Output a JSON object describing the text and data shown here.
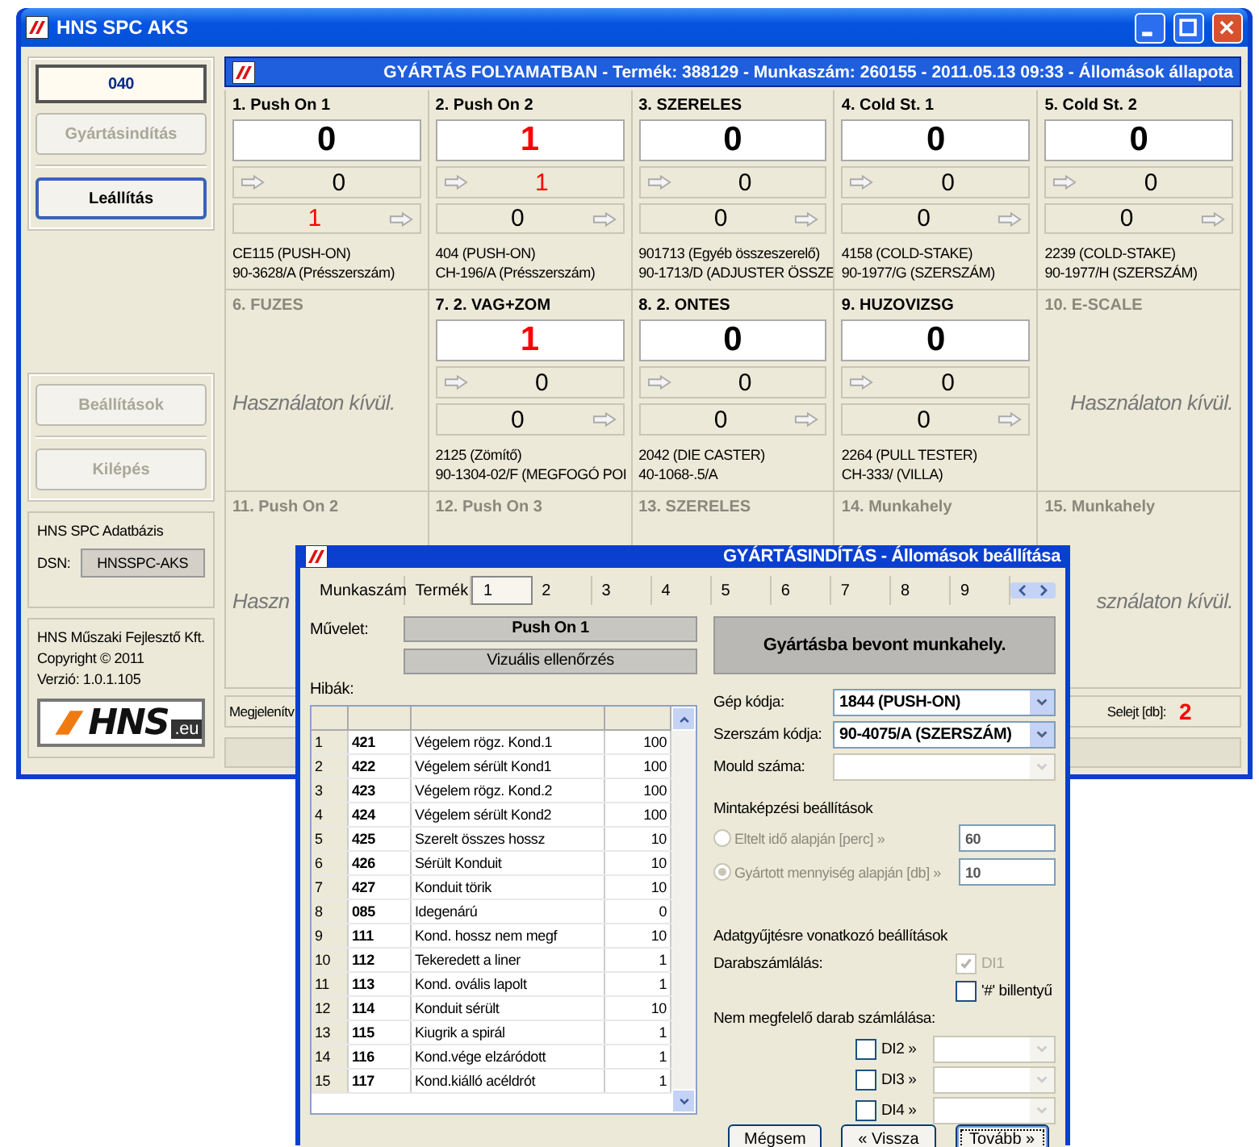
{
  "window": {
    "title": "HNS SPC AKS"
  },
  "sidebar": {
    "station_code": "040",
    "buttons": [
      {
        "label": "Gyártásindítás",
        "disabled": true
      },
      {
        "label": "Leállítás",
        "disabled": false
      }
    ],
    "buttons_lower": [
      {
        "label": "Beállítások",
        "disabled": true
      },
      {
        "label": "Kilépés",
        "disabled": true
      }
    ],
    "database": {
      "title": "HNS SPC Adatbázis",
      "dsn_label": "DSN:",
      "dsn": "HNSSPC-AKS"
    },
    "about": {
      "company": "HNS Műszaki Fejlesztő Kft.",
      "copyright": "Copyright © 2011",
      "version": "Verzió: 1.0.1.105",
      "logo": "HNS",
      "logo_suffix": ".eu"
    }
  },
  "header": "GYÁRTÁS FOLYAMATBAN - Termék: 388129 - Munkaszám: 260155 - 2011.05.13 09:33 - Állomások állapota",
  "stations": [
    {
      "kind": "active",
      "title": "1. Push On 1",
      "total": {
        "value": "0",
        "alert": false
      },
      "in": {
        "value": "0",
        "alert": false
      },
      "out": {
        "value": "1",
        "alert": true
      },
      "info": [
        "CE115 (PUSH-ON)",
        "90-3628/A (Présszerszám)"
      ]
    },
    {
      "kind": "active",
      "title": "2. Push On 2",
      "total": {
        "value": "1",
        "alert": true
      },
      "in": {
        "value": "1",
        "alert": true
      },
      "out": {
        "value": "0",
        "alert": false
      },
      "info": [
        "404 (PUSH-ON)",
        "CH-196/A (Présszerszám)"
      ]
    },
    {
      "kind": "active",
      "title": "3. SZERELES",
      "total": {
        "value": "0",
        "alert": false
      },
      "in": {
        "value": "0",
        "alert": false
      },
      "out": {
        "value": "0",
        "alert": false
      },
      "info": [
        "901713 (Egyéb összeszerelő)",
        "90-1713/D (ADJUSTER ÖSSZE"
      ]
    },
    {
      "kind": "active",
      "title": "4. Cold St. 1",
      "total": {
        "value": "0",
        "alert": false
      },
      "in": {
        "value": "0",
        "alert": false
      },
      "out": {
        "value": "0",
        "alert": false
      },
      "info": [
        "4158 (COLD-STAKE)",
        "90-1977/G (SZERSZÁM)"
      ]
    },
    {
      "kind": "active",
      "title": "5. Cold St. 2",
      "total": {
        "value": "0",
        "alert": false
      },
      "in": {
        "value": "0",
        "alert": false
      },
      "out": {
        "value": "0",
        "alert": false
      },
      "info": [
        "2239 (COLD-STAKE)",
        "90-1977/H (SZERSZÁM)"
      ]
    },
    {
      "kind": "out_of_use",
      "title": "6. FUZES",
      "status": "Használaton kívül."
    },
    {
      "kind": "active",
      "title": "7. 2. VAG+ZOM",
      "total": {
        "value": "1",
        "alert": true
      },
      "in": {
        "value": "0",
        "alert": false
      },
      "out": {
        "value": "0",
        "alert": false
      },
      "info": [
        "2125 (Zömítő)",
        "90-1304-02/F (MEGFOGÓ POI"
      ]
    },
    {
      "kind": "active",
      "title": "8. 2. ONTES",
      "total": {
        "value": "0",
        "alert": false
      },
      "in": {
        "value": "0",
        "alert": false
      },
      "out": {
        "value": "0",
        "alert": false
      },
      "info": [
        "2042 (DIE CASTER)",
        "40-1068-.5/A"
      ]
    },
    {
      "kind": "active",
      "title": "9. HUZOVIZSG",
      "total": {
        "value": "0",
        "alert": false
      },
      "in": {
        "value": "0",
        "alert": false
      },
      "out": {
        "value": "0",
        "alert": false
      },
      "info": [
        "2264 (PULL TESTER)",
        "CH-333/ (VILLA)"
      ]
    },
    {
      "kind": "out_of_use",
      "title": "10. E-SCALE",
      "status": "Használaton kívül."
    },
    {
      "kind": "out_of_use",
      "title": "11. Push On 2",
      "status": "Haszn"
    },
    {
      "kind": "out_of_use",
      "title": "12. Push On 3"
    },
    {
      "kind": "out_of_use",
      "title": "13. SZERELES"
    },
    {
      "kind": "out_of_use",
      "title": "14. Munkahely"
    },
    {
      "kind": "out_of_use",
      "title": "15. Munkahely",
      "status": "sználaton kívül."
    }
  ],
  "status_bar": {
    "label": "Megjelenítv",
    "reject_label": "Selejt [db]:",
    "reject_value": "2"
  },
  "dialog": {
    "title": "GYÁRTÁSINDÍTÁS - Állomások beállítása",
    "tabs": [
      {
        "label": "Munkaszám",
        "selected": false
      },
      {
        "label": "Termék",
        "selected": false
      },
      {
        "label": "1",
        "selected": true
      },
      {
        "label": "2",
        "selected": false
      },
      {
        "label": "3",
        "selected": false
      },
      {
        "label": "4",
        "selected": false
      },
      {
        "label": "5",
        "selected": false
      },
      {
        "label": "6",
        "selected": false
      },
      {
        "label": "7",
        "selected": false
      },
      {
        "label": "8",
        "selected": false
      },
      {
        "label": "9",
        "selected": false
      }
    ],
    "operation_label": "Művelet:",
    "operation": "Push On 1",
    "check_type": "Vizuális ellenőrzés",
    "defects_label": "Hibák:",
    "defects": [
      {
        "index": "1",
        "code": "421",
        "name": "Végelem rögz. Kond.1",
        "limit": "100"
      },
      {
        "index": "2",
        "code": "422",
        "name": "Végelem sérült Kond1",
        "limit": "100"
      },
      {
        "index": "3",
        "code": "423",
        "name": "Végelem rögz. Kond.2",
        "limit": "100"
      },
      {
        "index": "4",
        "code": "424",
        "name": "Végelem sérült Kond2",
        "limit": "100"
      },
      {
        "index": "5",
        "code": "425",
        "name": "Szerelt összes hossz",
        "limit": "10"
      },
      {
        "index": "6",
        "code": "426",
        "name": "Sérült Konduit",
        "limit": "10"
      },
      {
        "index": "7",
        "code": "427",
        "name": "Konduit törik",
        "limit": "10"
      },
      {
        "index": "8",
        "code": "085",
        "name": "Idegenárú",
        "limit": "0"
      },
      {
        "index": "9",
        "code": "111",
        "name": "Kond. hossz nem megf",
        "limit": "10"
      },
      {
        "index": "10",
        "code": "112",
        "name": "Tekeredett a liner",
        "limit": "1"
      },
      {
        "index": "11",
        "code": "113",
        "name": "Kond. ovális lapolt",
        "limit": "1"
      },
      {
        "index": "12",
        "code": "114",
        "name": "Konduit sérült",
        "limit": "10"
      },
      {
        "index": "13",
        "code": "115",
        "name": "Kiugrik a spirál",
        "limit": "1"
      },
      {
        "index": "14",
        "code": "116",
        "name": "Kond.vége elzáródott",
        "limit": "1"
      },
      {
        "index": "15",
        "code": "117",
        "name": "Kond.kiálló acéldrót",
        "limit": "1"
      }
    ],
    "status": "Gyártásba bevont munkahely.",
    "fields": [
      {
        "label": "Gép kódja:",
        "value": "1844 (PUSH-ON)",
        "disabled": false
      },
      {
        "label": "Szerszám kódja:",
        "value": "90-4075/A (SZERSZÁM)",
        "disabled": false
      },
      {
        "label": "Mould száma:",
        "disabled": true
      }
    ],
    "sampling": {
      "title": "Mintaképzési beállítások",
      "options": [
        {
          "label": "Eltelt idő alapján [perc] »",
          "value": "60",
          "selected": false,
          "disabled": true
        },
        {
          "label": "Gyártott mennyiség alapján [db] »",
          "value": "10",
          "selected": true,
          "disabled": true
        }
      ]
    },
    "collection": {
      "title": "Adatgyűjtésre vonatkozó beállítások",
      "count_label": "Darabszámlálás:",
      "count_options": [
        {
          "label": "DI1",
          "checked": true,
          "disabled": true
        },
        {
          "label": "'#' billentyű",
          "checked": false,
          "disabled": false
        }
      ],
      "reject_label": "Nem megfelelő darab számlálása:",
      "reject_inputs": [
        {
          "label": "DI2 »",
          "checked": false
        },
        {
          "label": "DI3 »",
          "checked": false
        },
        {
          "label": "DI4 »",
          "checked": false
        }
      ]
    },
    "buttons": [
      {
        "label": "Mégsem",
        "focused": false
      },
      {
        "label": "« Vissza",
        "focused": false
      },
      {
        "label": "Tovább »",
        "focused": true
      }
    ]
  }
}
